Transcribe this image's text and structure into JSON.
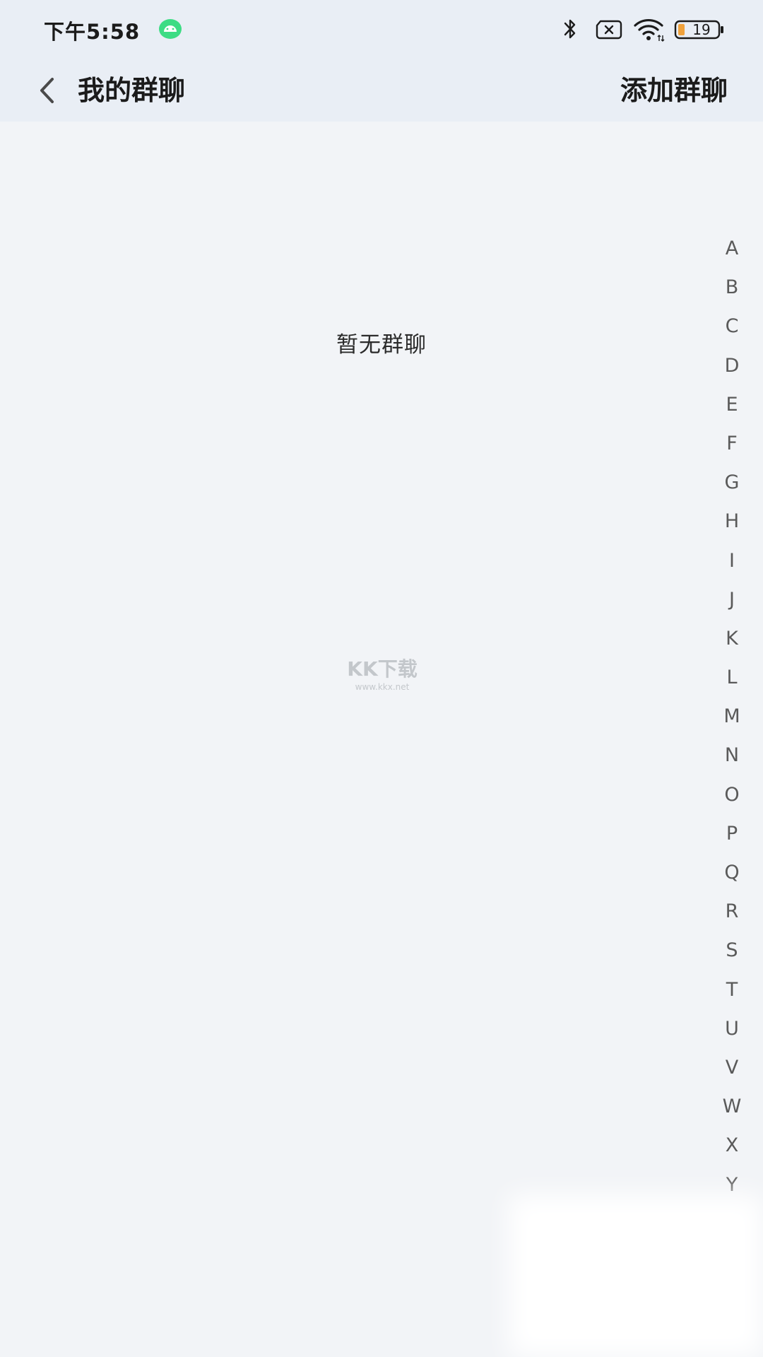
{
  "status_bar": {
    "time": "下午5:58",
    "battery": "19",
    "icons": [
      "android-icon",
      "bluetooth-icon",
      "no-sim-icon",
      "wifi-icon",
      "battery-icon"
    ]
  },
  "header": {
    "back_icon": "back-chevron-icon",
    "title": "我的群聊",
    "action_label": "添加群聊"
  },
  "main": {
    "empty_text": "暂无群聊"
  },
  "watermark": {
    "main": "KK下载",
    "sub": "www.kkx.net"
  },
  "alphabet_index": [
    "A",
    "B",
    "C",
    "D",
    "E",
    "F",
    "G",
    "H",
    "I",
    "J",
    "K",
    "L",
    "M",
    "N",
    "O",
    "P",
    "Q",
    "R",
    "S",
    "T",
    "U",
    "V",
    "W",
    "X",
    "Y"
  ],
  "colors": {
    "header_bg": "#e9eef5",
    "page_bg": "#f2f4f7",
    "battery_fill": "#f0a23c",
    "android_green": "#3ddc84"
  }
}
